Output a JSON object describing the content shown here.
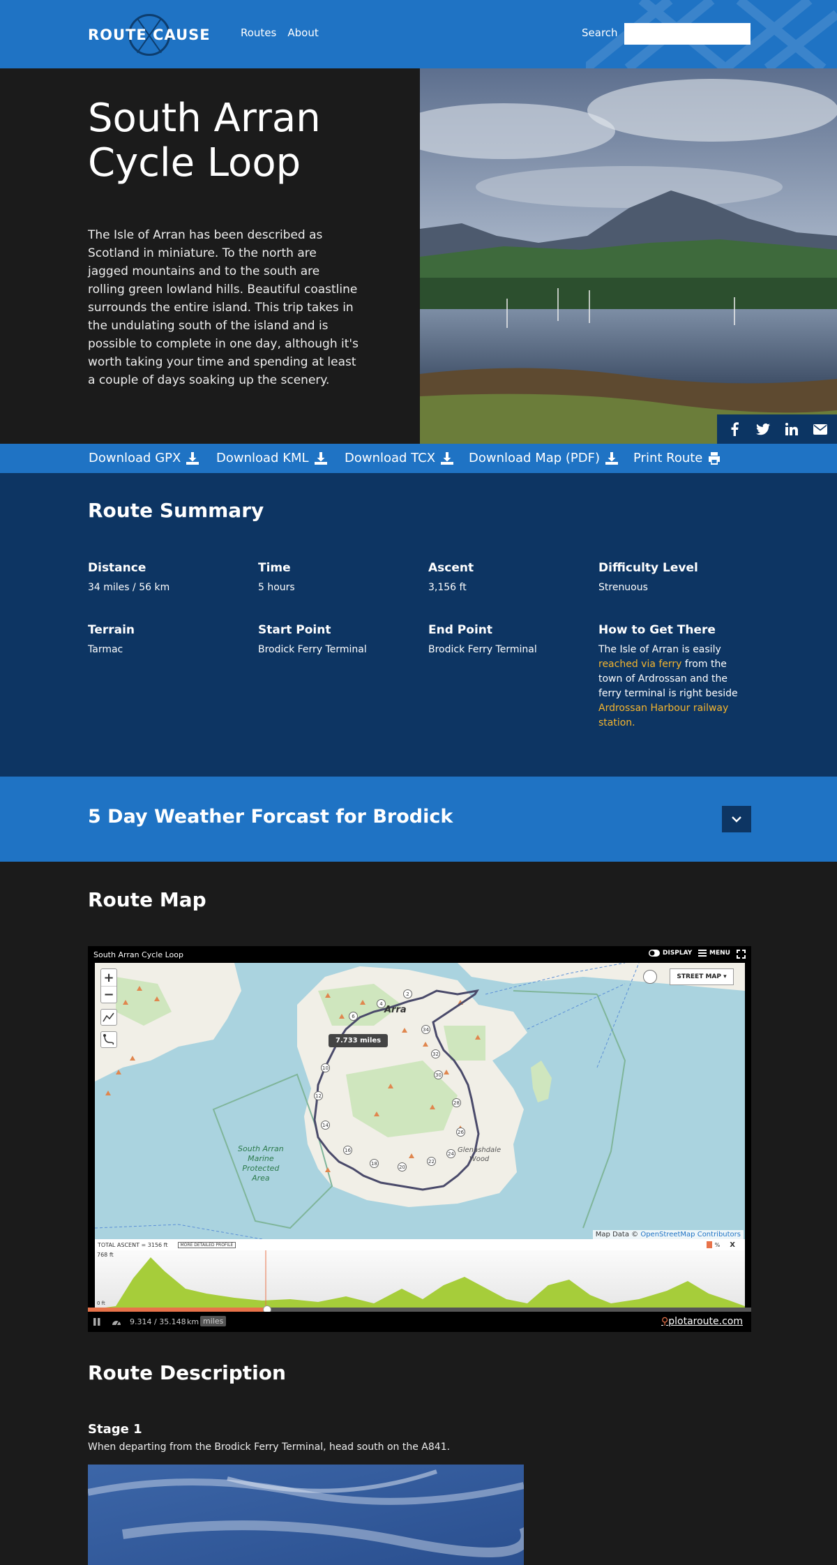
{
  "header": {
    "logo_text": "ROUTE CAUSE",
    "nav": [
      "Routes",
      "About"
    ],
    "search_label": "Search",
    "search_value": "",
    "color": "#1f73c4"
  },
  "hero": {
    "title": "South Arran Cycle Loop",
    "description": "The Isle of Arran has been described as Scotland in miniature. To the north are jagged mountains and to the south are rolling green lowland hills. Beautiful coastline surrounds the entire island. This trip takes in the undulating south of the island and is possible to complete in one day, although it's worth taking your time and spending at least a couple of days soaking up the scenery.",
    "share_icons": [
      "facebook-icon",
      "twitter-icon",
      "linkedin-icon",
      "email-icon"
    ]
  },
  "downloads": {
    "items": [
      "Download GPX",
      "Download KML",
      "Download TCX",
      "Download Map (PDF)",
      "Print Route"
    ]
  },
  "summary": {
    "title": "Route Summary",
    "distance_label": "Distance",
    "distance": "34 miles / 56 km",
    "time_label": "Time",
    "time": "5 hours",
    "ascent_label": "Ascent",
    "ascent": "3,156 ft",
    "difficulty_label": "Difficulty Level",
    "difficulty": "Strenuous",
    "terrain_label": "Terrain",
    "terrain": "Tarmac",
    "start_label": "Start Point",
    "start": "Brodick Ferry Terminal",
    "end_label": "End Point",
    "end": "Brodick Ferry Terminal",
    "how_label": "How to Get There",
    "how_1": "The Isle of Arran is easily",
    "how_link1": "reached via ferry",
    "how_2": " from the town of Ardrossan and the ferry terminal is right beside ",
    "how_link2": "Ardrossan Harbour railway station.",
    "accent_color": "#f5b52e",
    "bg_color": "#0d3563"
  },
  "weather": {
    "title": "5 Day Weather Forcast for Brodick",
    "toggle_icon": "chevron-down-icon"
  },
  "route_map": {
    "title": "Route Map",
    "map_title": "South Arran Cycle Loop",
    "display_label": "DISPLAY",
    "menu_label": "MENU",
    "layer": "STREET MAP",
    "tooltip": "7.733 miles",
    "place_label": "Arra",
    "park_label_1": "South Arran",
    "park_label_2": "Marine",
    "park_label_3": "Protected",
    "park_label_4": "Area",
    "wood_label_1": "Glenashdale",
    "wood_label_2": "Wood",
    "attribution": "Map Data ©",
    "attribution_link": "OpenStreetMap Contributors",
    "total_ascent": "TOTAL ASCENT = 3156 ft",
    "detailed_profile": "MORE DETAILED PROFILE",
    "percent_label": "%",
    "close_label": "X",
    "elev_max": "768 ft",
    "elev_min": "0 ft",
    "distance_readout": "9.314 / 35.148",
    "unit_km": "km",
    "unit_miles": "miles",
    "brand": "plotaroute.com",
    "progress": 0.27,
    "markers": [
      "2",
      "4",
      "6",
      "10",
      "12",
      "14",
      "16",
      "18",
      "20",
      "22",
      "24",
      "26",
      "28",
      "30",
      "32",
      "34"
    ]
  },
  "description": {
    "title": "Route Description",
    "stage_title": "Stage 1",
    "stage_text": "When departing from the Brodick Ferry Terminal, head south on the A841."
  }
}
